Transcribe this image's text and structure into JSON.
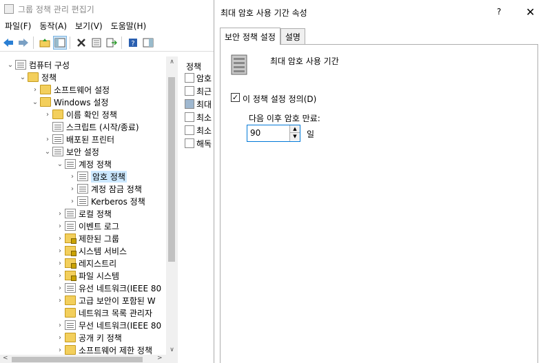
{
  "main_window": {
    "title": "그룹 정책 관리 편집기",
    "menu": [
      "파일(F)",
      "동작(A)",
      "보기(V)",
      "도움말(H)"
    ],
    "toolbar_icons": [
      "back-icon",
      "forward-icon",
      "up-folder-icon",
      "show-hide-tree-icon",
      "delete-icon",
      "properties-icon",
      "export-list-icon",
      "help-icon",
      "show-pane-icon"
    ]
  },
  "tree": [
    {
      "label": "컴퓨터 구성",
      "icon": "computer-icon",
      "expanded": true
    },
    {
      "label": "정책",
      "icon": "folder-icon",
      "expanded": true
    },
    {
      "label": "소프트웨어 설정",
      "icon": "folder-icon"
    },
    {
      "label": "Windows 설정",
      "icon": "folder-icon",
      "expanded": true
    },
    {
      "label": "이름 확인 정책",
      "icon": "folder-icon"
    },
    {
      "label": "스크립트 (시작/종료)",
      "icon": "script-icon"
    },
    {
      "label": "배포된 프린터",
      "icon": "printer-icon"
    },
    {
      "label": "보안 설정",
      "icon": "security-icon",
      "expanded": true
    },
    {
      "label": "계정 정책",
      "icon": "policy-icon",
      "expanded": true
    },
    {
      "label": "암호 정책",
      "icon": "policy-icon",
      "selected": true
    },
    {
      "label": "계정 잠금 정책",
      "icon": "policy-icon"
    },
    {
      "label": "Kerberos 정책",
      "icon": "policy-icon"
    },
    {
      "label": "로컬 정책",
      "icon": "policy-icon"
    },
    {
      "label": "이벤트 로그",
      "icon": "policy-icon"
    },
    {
      "label": "제한된 그룹",
      "icon": "lock-folder-icon"
    },
    {
      "label": "시스템 서비스",
      "icon": "lock-folder-icon"
    },
    {
      "label": "레지스트리",
      "icon": "lock-folder-icon"
    },
    {
      "label": "파일 시스템",
      "icon": "lock-folder-icon"
    },
    {
      "label": "유선 네트워크(IEEE 80",
      "icon": "wired-network-icon"
    },
    {
      "label": "고급 보안이 포함된 W",
      "icon": "firewall-icon"
    },
    {
      "label": "네트워크 목록 관리자",
      "icon": "folder-icon"
    },
    {
      "label": "무선 네트워크(IEEE 80",
      "icon": "wireless-network-icon"
    },
    {
      "label": "공개 키 정책",
      "icon": "folder-icon"
    },
    {
      "label": "소프트웨어 제한 정책",
      "icon": "folder-icon"
    }
  ],
  "list": {
    "header": "정책",
    "items": [
      "암호",
      "최근",
      "최대",
      "최소",
      "최소",
      "해독"
    ]
  },
  "dialog": {
    "title": "최대 암호 사용 기간 속성",
    "help": "?",
    "close": "✕",
    "tabs": [
      "보안 정책 설정",
      "설명"
    ],
    "policy_name": "최대 암호 사용 기간",
    "define_label": "이 정책 설정 정의(D)",
    "define_checked": true,
    "expire_label": "다음 이후 암호 만료:",
    "expire_value": "90",
    "unit": "일"
  }
}
